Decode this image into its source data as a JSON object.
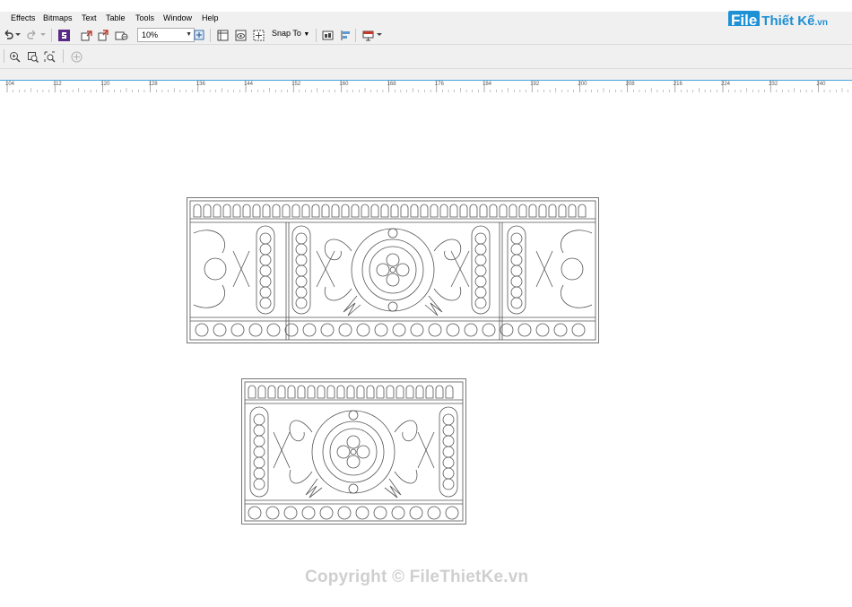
{
  "menu": {
    "items": [
      "Effects",
      "Bitmaps",
      "Text",
      "Table",
      "Tools",
      "Window",
      "Help"
    ]
  },
  "logo": {
    "brand": "File",
    "rest": "Thiết Kế",
    "suffix": ".vn"
  },
  "toolbar": {
    "zoom_value": "10%",
    "snap_label": "Snap To",
    "icons": [
      "undo-icon",
      "redo-icon",
      "corel-app-icon",
      "import-icon",
      "export-icon",
      "publish-icon",
      "zoom-level-select",
      "full-screen-icon",
      "show-rulers-icon",
      "view-icon",
      "snap-icon",
      "options-icon",
      "align-icon",
      "launch-icon"
    ]
  },
  "toolbar2": {
    "icons": [
      "zoom-in-icon",
      "zoom-page-icon",
      "zoom-selection-icon",
      "add-icon"
    ]
  },
  "ruler": {
    "labels": [
      "104",
      "112",
      "120",
      "128",
      "136",
      "144",
      "152",
      "160",
      "168",
      "176",
      "184",
      "192",
      "200",
      "208",
      "216",
      "224",
      "232",
      "240"
    ]
  },
  "watermark": "Copyright © FileThietKe.vn",
  "colors": {
    "toolbar_bg": "#f0f0f0",
    "ruler_accent": "#4aa3df",
    "logo_blue": "#1e90d6",
    "art_stroke": "#555555"
  }
}
